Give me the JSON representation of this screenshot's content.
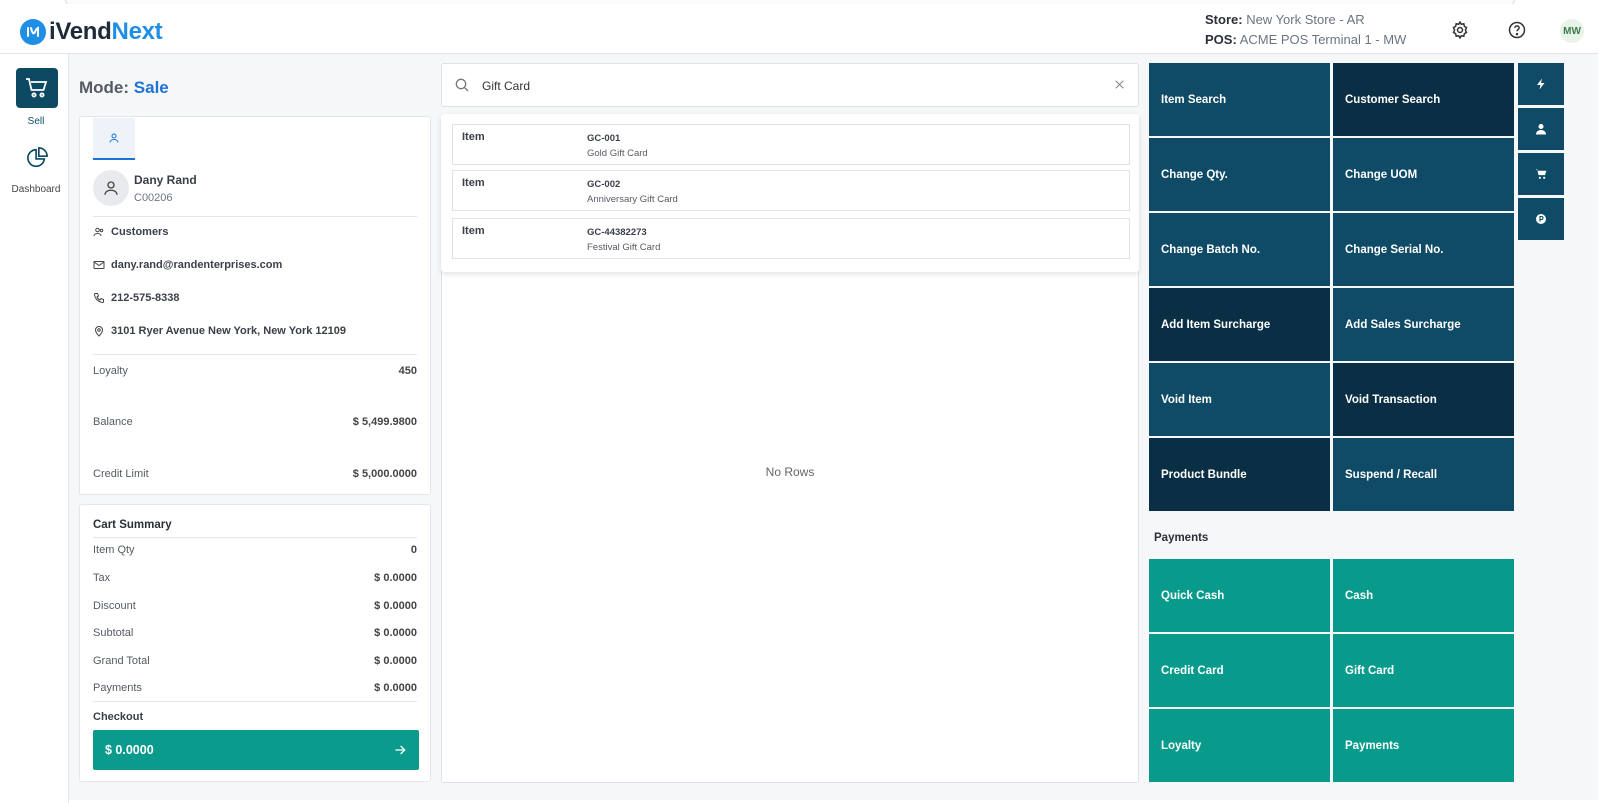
{
  "app": {
    "logo_part1": "iVend",
    "logo_part2": "Next"
  },
  "header": {
    "store_label": "Store:",
    "store_value": "New York Store - AR",
    "pos_label": "POS:",
    "pos_value": "ACME POS Terminal 1 - MW",
    "user_initials": "MW"
  },
  "rail": {
    "sell_label": "Sell",
    "dashboard_label": "Dashboard"
  },
  "mode": {
    "label": "Mode:",
    "value": "Sale"
  },
  "customer": {
    "name": "Dany Rand",
    "code": "C00206",
    "group": "Customers",
    "email": "dany.rand@randenterprises.com",
    "phone": "212-575-8338",
    "address": "3101 Ryer Avenue New York, New York 12109",
    "loyalty_label": "Loyalty",
    "loyalty_value": "450",
    "balance_label": "Balance",
    "balance_value": "$ 5,499.9800",
    "credit_label": "Credit Limit",
    "credit_value": "$ 5,000.0000"
  },
  "cart": {
    "title": "Cart Summary",
    "rows": [
      {
        "label": "Item Qty",
        "value": "0"
      },
      {
        "label": "Tax",
        "value": "$ 0.0000"
      },
      {
        "label": "Discount",
        "value": "$ 0.0000"
      },
      {
        "label": "Subtotal",
        "value": "$ 0.0000"
      },
      {
        "label": "Grand Total",
        "value": "$ 0.0000"
      },
      {
        "label": "Payments",
        "value": "$ 0.0000"
      }
    ],
    "checkout_label": "Checkout",
    "checkout_amount": "$ 0.0000"
  },
  "search": {
    "value": "Gift Card",
    "results": [
      {
        "type": "Item",
        "code": "GC-001",
        "name": "Gold Gift Card"
      },
      {
        "type": "Item",
        "code": "GC-002",
        "name": "Anniversary Gift Card"
      },
      {
        "type": "Item",
        "code": "GC-44382273",
        "name": "Festival Gift Card"
      }
    ],
    "empty_text": "No Rows"
  },
  "actions": [
    "Item Search",
    "Customer Search",
    "Change Qty.",
    "Change UOM",
    "Change Batch No.",
    "Change Serial No.",
    "Add Item Surcharge",
    "Add Sales Surcharge",
    "Void Item",
    "Void Transaction",
    "Product Bundle",
    "Suspend / Recall"
  ],
  "payments": {
    "title": "Payments",
    "items": [
      "Quick Cash",
      "Cash",
      "Credit Card",
      "Gift Card",
      "Loyalty",
      "Payments"
    ]
  },
  "colors": {
    "brand_blue": "#1f8fe6",
    "tile_mid": "#0f4a66",
    "tile_dark": "#0a2f45",
    "teal": "#089b8c"
  }
}
